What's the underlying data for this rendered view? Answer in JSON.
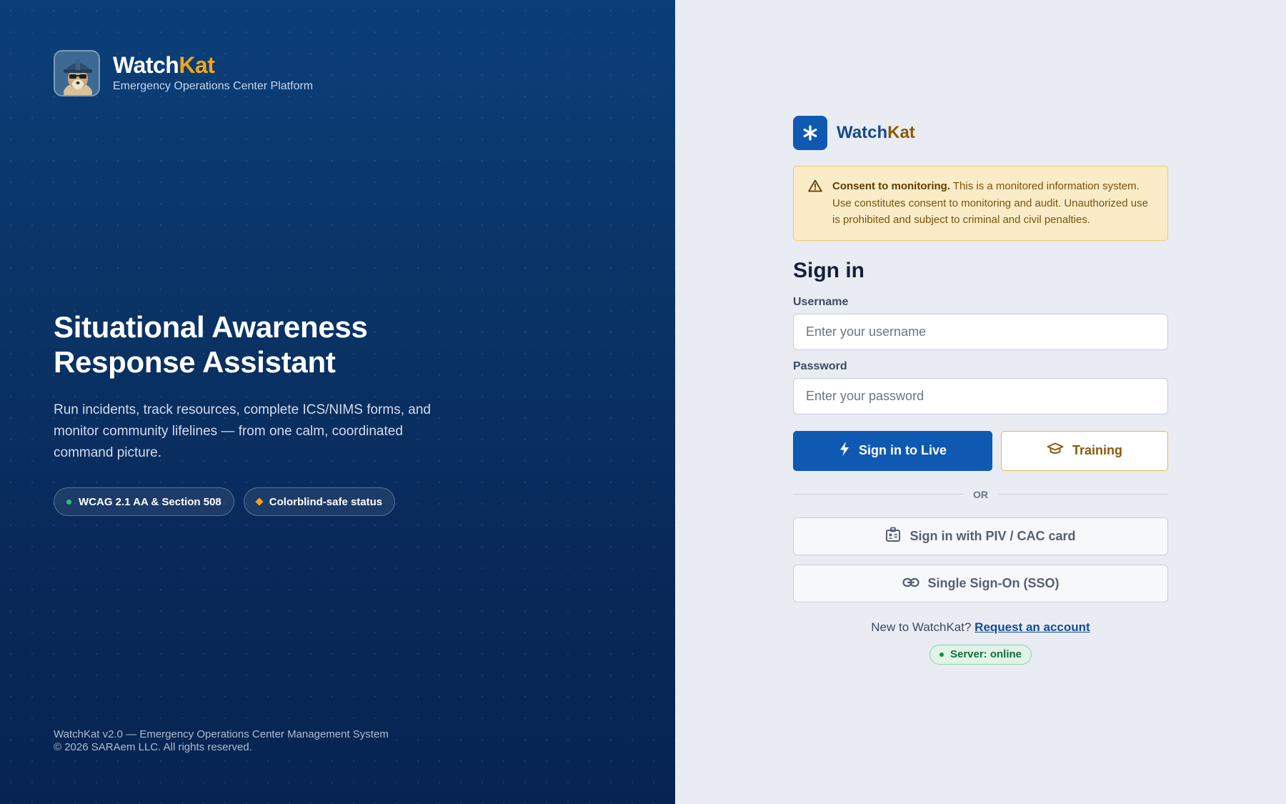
{
  "left": {
    "brand": {
      "name_main": "Watch",
      "name_accent": "Kat",
      "subtitle": "Emergency Operations Center Platform",
      "mascot_icon": "meerkat-hardhat-icon"
    },
    "hero": {
      "title_line1": "Situational Awareness",
      "title_line2": "Response Assistant",
      "description": "Run incidents, track resources, complete ICS/NIMS forms, and monitor community lifelines — from one calm, coordinated command picture."
    },
    "pills": [
      {
        "label": "WCAG 2.1 AA & Section 508",
        "icon": "green-dot-icon"
      },
      {
        "label": "Colorblind-safe status",
        "icon": "orange-diamond-icon"
      }
    ],
    "footer": {
      "line1": "WatchKat v2.0 — Emergency Operations Center Management System",
      "line2": "© 2026 SARAem LLC. All rights reserved."
    }
  },
  "right": {
    "logo": {
      "name_main": "Watch",
      "name_accent": "Kat",
      "icon": "asterisk-icon"
    },
    "consent": {
      "bold": "Consent to monitoring.",
      "text": " This is a monitored information system. Use constitutes consent to monitoring and audit. Unauthorized use is prohibited and subject to criminal and civil penalties.",
      "icon": "warning-triangle-icon"
    },
    "form": {
      "title": "Sign in",
      "username_label": "Username",
      "username_placeholder": "Enter your username",
      "username_value": "",
      "password_label": "Password",
      "password_placeholder": "Enter your password",
      "password_value": "",
      "live_button": "Sign in to Live",
      "training_button": "Training",
      "or_text": "OR",
      "piv_button": "Sign in with PIV / CAC card",
      "sso_button": "Single Sign-On (SSO)",
      "new_text": "New to WatchKat?",
      "request_link": "Request an account",
      "server_status": "Server: online"
    }
  },
  "colors": {
    "left_bg": "#0a3466",
    "accent_orange": "#f2a516",
    "primary_blue": "#1059b3",
    "right_bg": "#e9ecf3",
    "status_green": "#1f8a48"
  }
}
